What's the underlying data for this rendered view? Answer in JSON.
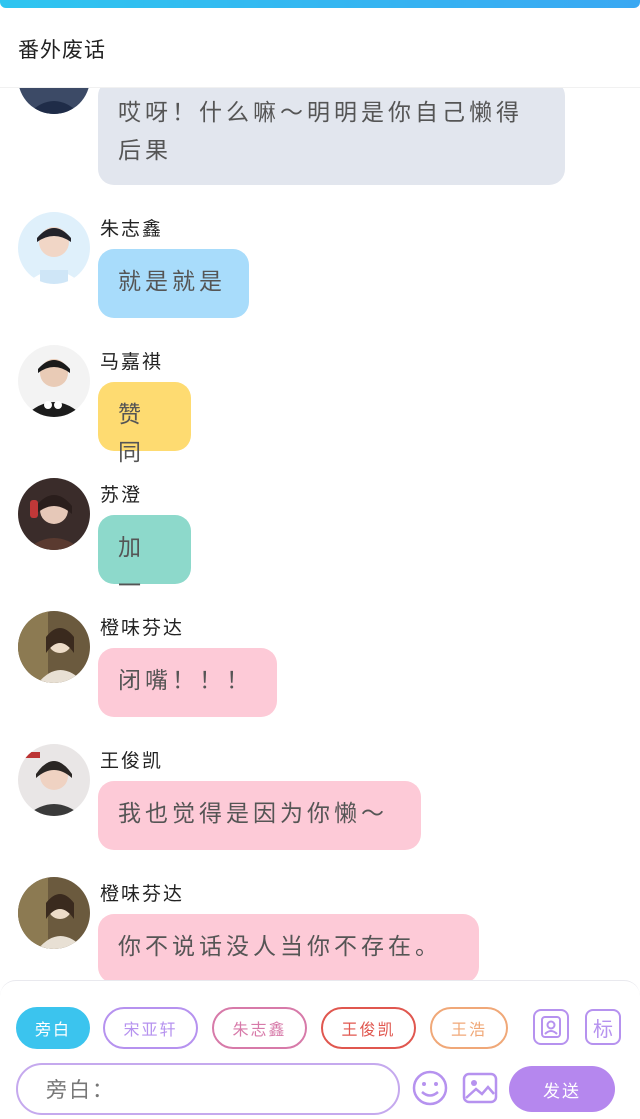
{
  "header": {
    "title": "番外废话"
  },
  "messages": [
    {
      "sender": "",
      "text": "哎呀！什么嘛～明明是你自己懒得后果",
      "bubble_color": "#e2e6ee"
    },
    {
      "sender": "朱志鑫",
      "text": "就是就是",
      "bubble_color": "#a8dcfb"
    },
    {
      "sender": "马嘉祺",
      "text": "赞同",
      "bubble_color": "#fedb71"
    },
    {
      "sender": "苏澄",
      "text": "加一",
      "bubble_color": "#8dd9cb"
    },
    {
      "sender": "橙味芬达",
      "text": "闭嘴！！！",
      "bubble_color": "#fdcad7"
    },
    {
      "sender": "王俊凯",
      "text": "我也觉得是因为你懒～",
      "bubble_color": "#fdcad7"
    },
    {
      "sender": "橙味芬达",
      "text": "你不说话没人当你不存在。",
      "bubble_color": "#fdcad7"
    }
  ],
  "composer": {
    "chips": [
      {
        "label": "旁白",
        "color": "#3bc4ee"
      },
      {
        "label": "宋亚轩",
        "color": "#b692ef"
      },
      {
        "label": "朱志鑫",
        "color": "#d77aa9"
      },
      {
        "label": "王俊凯",
        "color": "#e0574f"
      },
      {
        "label": "王浩",
        "color": "#f0a878"
      }
    ],
    "input_value": "旁白：",
    "send_label": "发送",
    "mark_label": "标",
    "icons": [
      "contact-card-icon",
      "mark-icon",
      "emoji-icon",
      "image-icon"
    ]
  }
}
